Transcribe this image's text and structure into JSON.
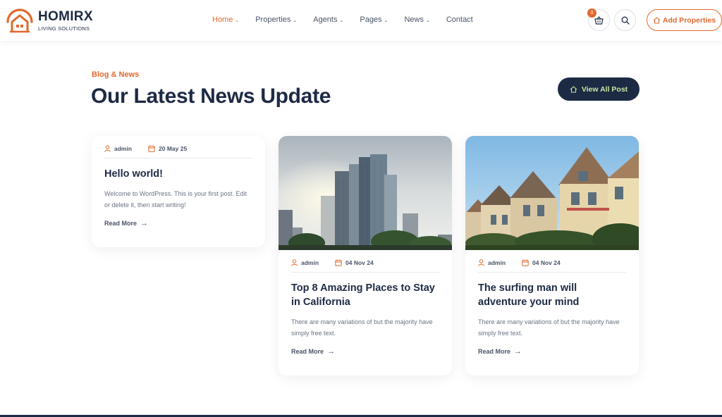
{
  "brand": {
    "name": "HOMIRX",
    "tagline": "LIVING SOLUTIONS",
    "accent_color": "#e0692e",
    "dark_color": "#1d2a44"
  },
  "nav": {
    "items": [
      {
        "label": "Home",
        "has_dropdown": true,
        "active": true
      },
      {
        "label": "Properties",
        "has_dropdown": true
      },
      {
        "label": "Agents",
        "has_dropdown": true
      },
      {
        "label": "Pages",
        "has_dropdown": true
      },
      {
        "label": "News",
        "has_dropdown": true
      },
      {
        "label": "Contact",
        "has_dropdown": false
      }
    ],
    "cart_count": "0",
    "add_button_label": "Add Properties"
  },
  "section": {
    "eyebrow": "Blog & News",
    "title": "Our Latest News Update",
    "view_all_label": "View All Post"
  },
  "posts": [
    {
      "author": "admin",
      "date": "20 May 25",
      "title": "Hello world!",
      "excerpt": "Welcome to WordPress. This is your first post. Edit or delete it, then start writing!",
      "read_more": "Read More",
      "image": "none"
    },
    {
      "author": "admin",
      "date": "04 Nov 24",
      "title": "Top 8 Amazing Places to Stay in California",
      "excerpt": "There are many variations of but the majority have simply free text.",
      "read_more": "Read More",
      "image": "city-skyscrapers"
    },
    {
      "author": "admin",
      "date": "04 Nov 24",
      "title": "The surfing man will adventure your mind",
      "excerpt": "There are many variations of but the majority have simply free text.",
      "read_more": "Read More",
      "image": "victorian-houses"
    }
  ]
}
